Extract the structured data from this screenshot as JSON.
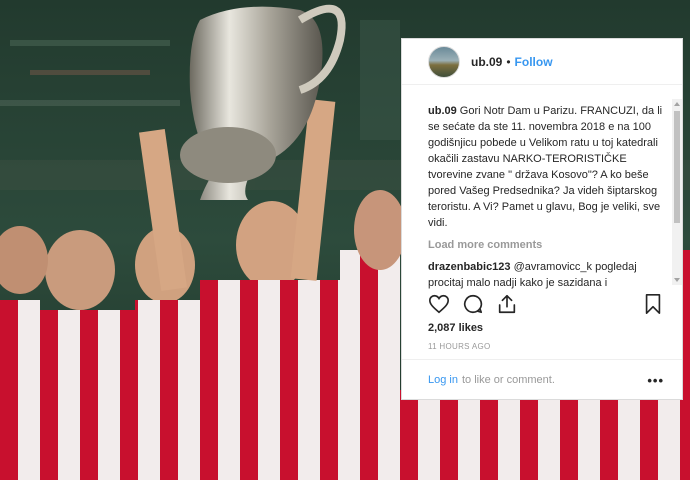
{
  "post": {
    "username": "ub.09",
    "separator": "•",
    "follow_label": "Follow",
    "caption_user": "ub.09",
    "caption_text": "Gori Notr Dam u Parizu. FRANCUZI, da li se sećate da ste 11. novembra 2018 e na 100 godišnjicu pobede u Velikom ratu u toj katedrali okačili zastavu NARKO-TERORISTIČKE tvorevine zvane \" država Kosovo\"? A ko beše pored Vašeg Predsednika? Ja videh šiptarskog teroristu. A Vi? Pamet u glavu, Bog je veliki, sve vidi.",
    "load_more": "Load more comments",
    "comment_user": "drazenbabic123",
    "comment_text": "@avramovicc_k pogledaj procitaj malo nadji kako je sazidana i",
    "likes": "2,087 likes",
    "time": "11 HOURS AGO",
    "login_link": "Log in",
    "login_rest": "to like or comment.",
    "more_glyph": "•••"
  },
  "icons": {
    "like": "heart-icon",
    "comment": "comment-icon",
    "share": "share-icon",
    "save": "bookmark-icon",
    "options": "ellipsis-icon"
  },
  "colors": {
    "link_blue": "#3897f0",
    "text_dark": "#262626",
    "text_muted": "#999999",
    "kit_red": "#c8102e"
  }
}
